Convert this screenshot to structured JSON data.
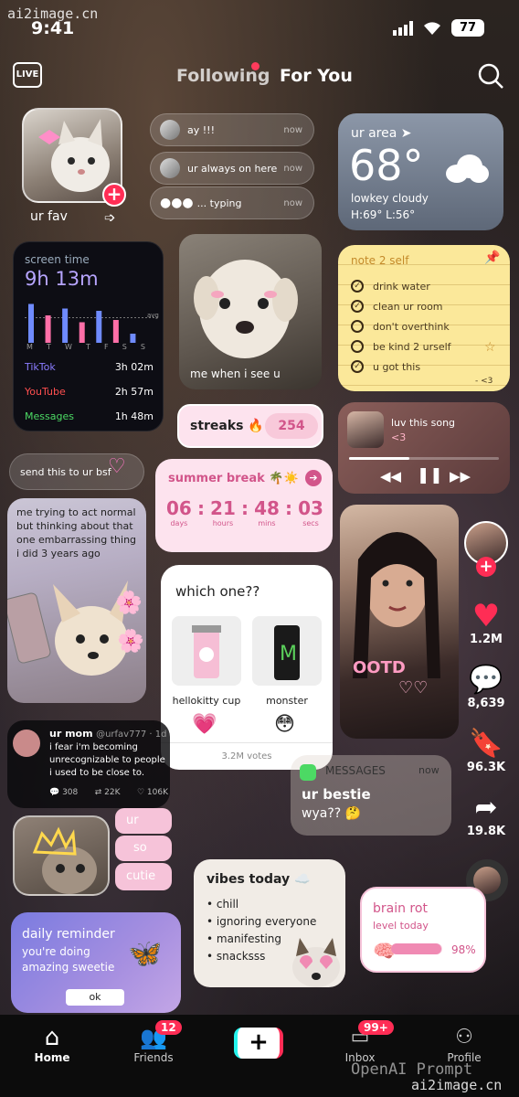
{
  "watermark_top": "ai2image.cn",
  "watermark_bottom": "ai2image.cn",
  "watermark_overlay": "OpenAI Prompt",
  "status": {
    "time": "9:41",
    "battery": "77"
  },
  "top_nav": {
    "live_label": "LIVE",
    "following": "Following",
    "for_you": "For You"
  },
  "fav": {
    "label": "ur fav"
  },
  "chats": [
    {
      "text": "ay !!!",
      "time": "now"
    },
    {
      "text": "ur always on here",
      "time": "now"
    },
    {
      "text": "... typing",
      "time": "now"
    }
  ],
  "weather": {
    "location": "ur area",
    "temp": "68°",
    "condition": "lowkey cloudy",
    "hilo": "H:69° L:56°"
  },
  "screen_time": {
    "title": "screen time",
    "total": "9h 13m",
    "avg_label": "avg",
    "days": [
      "M",
      "T",
      "W",
      "T",
      "F",
      "S",
      "S"
    ],
    "bars": [
      0.85,
      0.6,
      0.75,
      0.45,
      0.7,
      0.5,
      0.2
    ],
    "apps": [
      {
        "name": "TikTok",
        "time": "3h 02m",
        "color": "#8a7cff"
      },
      {
        "name": "YouTube",
        "time": "2h 57m",
        "color": "#ff4f4f"
      },
      {
        "name": "Messages",
        "time": "1h 48m",
        "color": "#4cd964"
      }
    ]
  },
  "dog_meme": {
    "caption": "me when i see u"
  },
  "note": {
    "title": "note 2 self",
    "items": [
      {
        "text": "drink water",
        "done": true
      },
      {
        "text": "clean ur room",
        "done": true
      },
      {
        "text": "don't overthink",
        "done": false
      },
      {
        "text": "be kind 2 urself",
        "done": false
      },
      {
        "text": "u got this",
        "done": true
      }
    ],
    "sig": "- <3"
  },
  "streaks": {
    "label": "streaks 🔥",
    "count": "254"
  },
  "music": {
    "title": "luv this song",
    "sub": "<3",
    "progress": 0.4
  },
  "bsf": {
    "text": "send this to ur bsf"
  },
  "countdown": {
    "title": "summer break 🌴☀️",
    "units": [
      {
        "num": "06",
        "label": "days"
      },
      {
        "num": "21",
        "label": "hours"
      },
      {
        "num": "48",
        "label": "mins"
      },
      {
        "num": "03",
        "label": "secs"
      }
    ]
  },
  "chihuahua": {
    "caption": "me trying to act normal but thinking about that one embarrassing thing i did 3 years ago"
  },
  "poll": {
    "question": "which one??",
    "options": [
      {
        "label": "hellokitty cup",
        "emoji": "💗"
      },
      {
        "label": "monster",
        "emoji": "😳"
      }
    ],
    "votes": "3.2M votes"
  },
  "ootd": {
    "text": "OOTD"
  },
  "rail": {
    "likes": "1.2M",
    "comments": "8,639",
    "saves": "96.3K",
    "shares": "19.8K"
  },
  "tweet": {
    "name": "ur mom",
    "handle": "@urfav777 · 1d",
    "text": "i fear i'm becoming unrecognizable to people i used to be close to.",
    "replies": "308",
    "retweets": "22K",
    "likes": "106K"
  },
  "messages": {
    "app": "MESSAGES",
    "time": "now",
    "sender": "ur bestie",
    "body": "wya?? 🤔"
  },
  "cutie": {
    "words": [
      "ur",
      "so",
      "cutie"
    ]
  },
  "vibes": {
    "title": "vibes today ☁️",
    "items": [
      "chill",
      "ignoring everyone",
      "manifesting",
      "snacksss"
    ]
  },
  "brainrot": {
    "title": "brain rot",
    "sub": "level today",
    "percent": "98%",
    "level": 0.98
  },
  "reminder": {
    "title": "daily reminder",
    "line1": "you're doing",
    "line2": "amazing sweetie",
    "button": "ok"
  },
  "bottom_nav": {
    "home": "Home",
    "friends": "Friends",
    "friends_badge": "12",
    "inbox": "Inbox",
    "inbox_badge": "99+",
    "profile": "Profile"
  },
  "colors": {
    "accent": "#ff2d55",
    "pink": "#d2558a",
    "note": "#fbe89a"
  }
}
